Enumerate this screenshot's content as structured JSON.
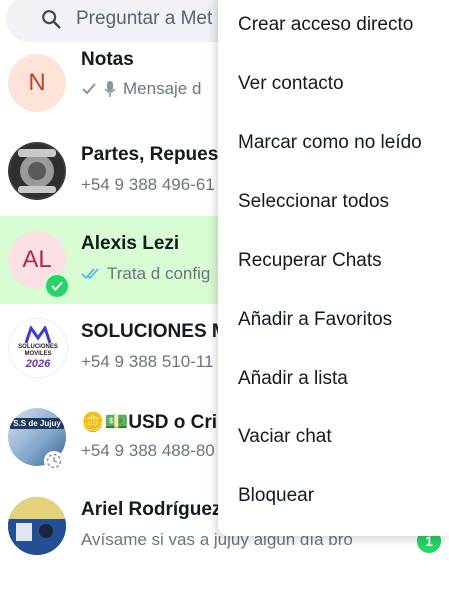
{
  "search": {
    "placeholder": "Preguntar a Met"
  },
  "chats": [
    {
      "name": "Notas",
      "avatar_letter": "N",
      "preview": "Mensaje d",
      "unread": ""
    },
    {
      "name": "Partes, Repuest",
      "preview": "+54 9 388 496-61"
    },
    {
      "name": "Alexis Lezi",
      "avatar_letter": "AL",
      "preview": "Trata d config",
      "selected": true
    },
    {
      "name": "SOLUCIONES M",
      "preview": "+54 9 388 510-11",
      "avatar_text": {
        "line1": "SOLUCIONES",
        "line2": "MOVILES",
        "line3": "2026"
      }
    },
    {
      "name": "🪙💵USD o Crip",
      "preview": "+54 9 388 488-80",
      "avatar_text": {
        "line1": "S.S de Jujuy"
      }
    },
    {
      "name": "Ariel Rodríguez",
      "preview": "Avísame si vas a jujuy algún día bro",
      "unread": "1"
    }
  ],
  "menu": {
    "items": [
      "Crear acceso directo",
      "Ver contacto",
      "Marcar como no leído",
      "Seleccionar todos",
      "Recuperar Chats",
      "Añadir a Favoritos",
      "Añadir a lista",
      "Vaciar chat",
      "Bloquear"
    ]
  },
  "colors": {
    "accent": "#25d366",
    "selected_row": "#d9fdd3",
    "read_ticks": "#53bdeb"
  }
}
